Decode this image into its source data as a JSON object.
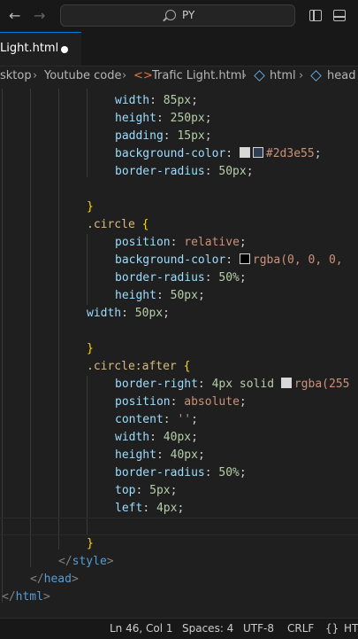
{
  "titlebar": {
    "back_icon": "arrow-left-icon",
    "forward_icon": "arrow-right-icon",
    "search_text": "PY"
  },
  "tab": {
    "label": "Light.html"
  },
  "breadcrumb": [
    "sktop",
    "Youtube code",
    "Trafic Light.html",
    "html",
    "head"
  ],
  "code": {
    "l0": [
      "width",
      ": ",
      "85px",
      ";"
    ],
    "l1": [
      "height",
      ": ",
      "250px",
      ";"
    ],
    "l2": [
      "padding",
      ": ",
      "15px",
      ";"
    ],
    "l3": [
      "background-color",
      ": ",
      "#2d3e55",
      ";"
    ],
    "l4": [
      "border-radius",
      ": ",
      "50px",
      ";"
    ],
    "l6": [
      "}"
    ],
    "l7": [
      ".circle",
      " {"
    ],
    "l8": [
      "position",
      ": ",
      "relative",
      ";"
    ],
    "l9": [
      "background-color",
      ": ",
      "rgba(0, 0, 0,"
    ],
    "l10": [
      "border-radius",
      ": ",
      "50%",
      ";"
    ],
    "l11": [
      "height",
      ": ",
      "50px",
      ";"
    ],
    "l12": [
      "width",
      ": ",
      "50px",
      ";"
    ],
    "l14": [
      "}"
    ],
    "l15": [
      ".circle:after",
      " {"
    ],
    "l16": [
      "border-right",
      ": ",
      "4px solid ",
      "rgba(255"
    ],
    "l17": [
      "position",
      ": ",
      "absolute",
      ";"
    ],
    "l18": [
      "content",
      ": ",
      "''",
      ";"
    ],
    "l19": [
      "width",
      ": ",
      "40px",
      ";"
    ],
    "l20": [
      "height",
      ": ",
      "40px",
      ";"
    ],
    "l21": [
      "border-radius",
      ": ",
      "50%",
      ";"
    ],
    "l22": [
      "top",
      ": ",
      "5px",
      ";"
    ],
    "l23": [
      "left",
      ": ",
      "4px",
      ";"
    ],
    "l25": [
      "}"
    ],
    "l26": [
      "</",
      "style",
      ">"
    ],
    "l27": [
      "</",
      "head",
      ">"
    ],
    "l28": [
      "</",
      "html",
      ">"
    ]
  },
  "colors": {
    "swatch_dark": "#2d3e55",
    "swatch_black": "#000000",
    "swatch_light": "#d8d8d8"
  },
  "status": {
    "position": "Ln 46, Col 1",
    "spaces": "Spaces: 4",
    "encoding": "UTF-8",
    "eol": "CRLF",
    "lang": "HT"
  }
}
